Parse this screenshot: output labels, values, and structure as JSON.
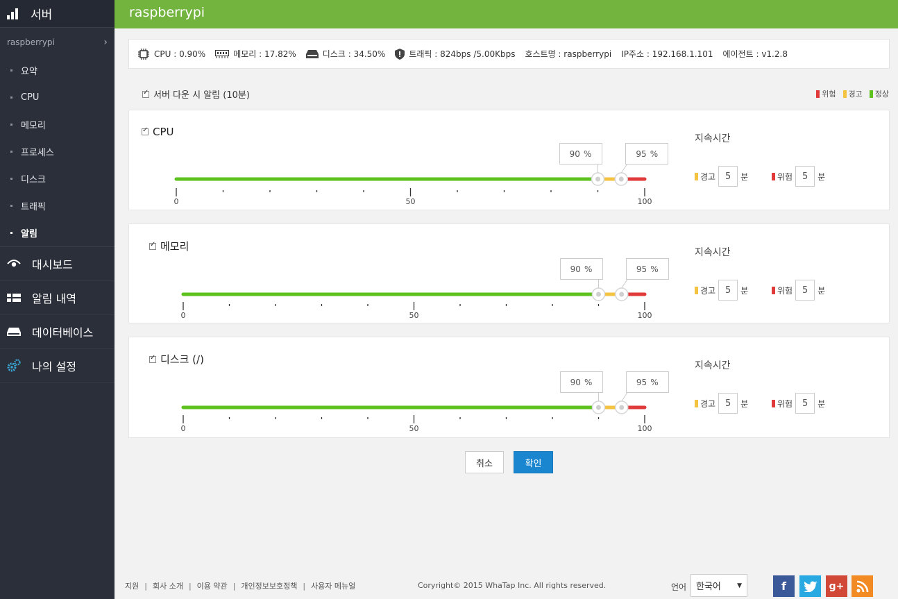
{
  "sidebar": {
    "title": "서버",
    "server_name": "raspberrypi",
    "sub_items": [
      {
        "label": "요약"
      },
      {
        "label": "CPU"
      },
      {
        "label": "메모리"
      },
      {
        "label": "프로세스"
      },
      {
        "label": "디스크"
      },
      {
        "label": "트래픽"
      },
      {
        "label": "알림"
      }
    ],
    "active_sub": "알림",
    "main_items": [
      {
        "label": "대시보드",
        "icon": "eye-icon"
      },
      {
        "label": "알림 내역",
        "icon": "list-icon"
      },
      {
        "label": "데이터베이스",
        "icon": "database-icon"
      },
      {
        "label": "나의 설정",
        "icon": "gears-icon"
      }
    ]
  },
  "header": {
    "title": "raspberrypi"
  },
  "info": {
    "cpu": "CPU : 0.90%",
    "memory": "메모리 : 17.82%",
    "disk": "디스크 : 34.50%",
    "traffic": "트래픽 : 824bps /5.00Kbps",
    "hostname": "호스트명 : raspberrypi",
    "ip": "IP주소 : 192.168.1.101",
    "agent": "에이전트 : v1.2.8"
  },
  "alert_option": {
    "label": "서버 다운 시 알림 (10분)",
    "checked": true
  },
  "legend": [
    {
      "label": "위험",
      "color": "#e03a3a"
    },
    {
      "label": "경고",
      "color": "#f5c342"
    },
    {
      "label": "정상",
      "color": "#5dc21e"
    }
  ],
  "duration_title": "지속시간",
  "duration_warn_label": "경고",
  "duration_danger_label": "위험",
  "duration_unit": "분",
  "percent_sign": "%",
  "panels": [
    {
      "title": "CPU",
      "checked": true,
      "warn": 90,
      "danger": 95,
      "warn_minutes": "5",
      "danger_minutes": "5",
      "ticks": {
        "min": "0",
        "mid": "50",
        "max": "100"
      }
    },
    {
      "title": "메모리",
      "checked": true,
      "warn": 90,
      "danger": 95,
      "warn_minutes": "5",
      "danger_minutes": "5",
      "ticks": {
        "min": "0",
        "mid": "50",
        "max": "100"
      }
    },
    {
      "title": "디스크 (/)",
      "checked": true,
      "warn": 90,
      "danger": 95,
      "warn_minutes": "5",
      "danger_minutes": "5",
      "ticks": {
        "min": "0",
        "mid": "50",
        "max": "100"
      }
    }
  ],
  "buttons": {
    "cancel": "취소",
    "ok": "확인"
  },
  "footer": {
    "links": [
      "지원",
      "회사 소개",
      "이용 약관",
      "개인정보보호정책",
      "사용자 메뉴얼"
    ],
    "separator": "|",
    "copyright": "Coryright© 2015 WhaTap Inc. All rights reserved.",
    "language_label": "언어",
    "language_value": "한국어",
    "social": [
      {
        "name": "facebook",
        "glyph": "f",
        "color": "#3b5998"
      },
      {
        "name": "twitter",
        "glyph": "t",
        "color": "#29a9e1"
      },
      {
        "name": "google-plus",
        "glyph": "g+",
        "color": "#d14836"
      },
      {
        "name": "rss",
        "glyph": "rss",
        "color": "#f38b24"
      }
    ]
  },
  "colors": {
    "green": "#5dc21e",
    "yellow": "#f5c342",
    "red": "#e03a3a",
    "header": "#73b43f",
    "primary": "#1a86d0"
  }
}
